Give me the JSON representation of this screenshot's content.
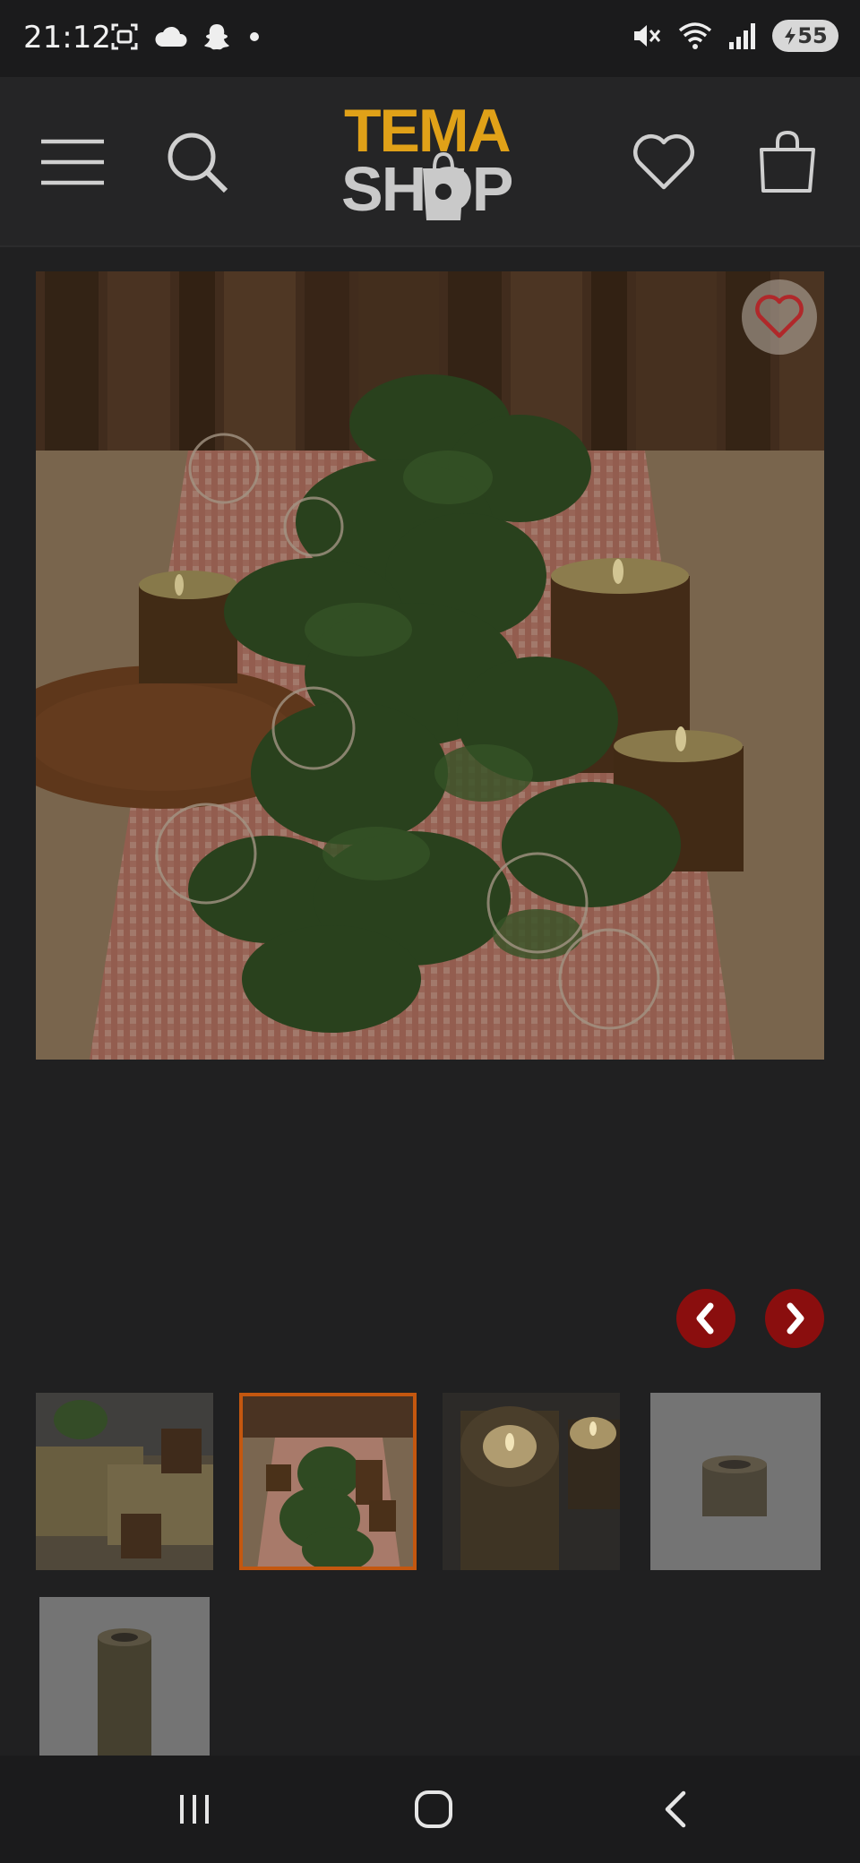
{
  "status_bar": {
    "time": "21:12",
    "battery_level": "55",
    "left_icons": [
      "screenshot-icon",
      "cloud-icon",
      "snapchat-icon",
      "notification-dot-icon"
    ],
    "right_icons": [
      "mute-icon",
      "wifi-icon",
      "signal-icon",
      "battery-charging-icon"
    ]
  },
  "header": {
    "logo_top": "TEMA",
    "logo_bottom": "SHOP",
    "icons": [
      "menu-icon",
      "search-icon",
      "wishlist-icon",
      "cart-icon"
    ],
    "brand_color": "#e0a118"
  },
  "product": {
    "main_image": "table-runner-with-ivy-garland-candles-and-bulbs",
    "favorite_icon": "heart-icon"
  },
  "gallery": {
    "prev_icon": "chevron-left-icon",
    "next_icon": "chevron-right-icon",
    "arrow_color": "#8a0e0e",
    "selected_border_color": "#c4570f",
    "thumbnails": [
      {
        "image": "hay-bales-with-wooden-candle-holders",
        "selected": false
      },
      {
        "image": "table-runner-with-ivy-garland",
        "selected": true
      },
      {
        "image": "wooden-tealight-holders-closeup",
        "selected": false
      },
      {
        "image": "small-wooden-tealight-holder",
        "selected": false
      },
      {
        "image": "tall-wooden-candle-holder",
        "selected": false
      }
    ]
  },
  "nav_bar": {
    "icons": [
      "recent-apps-icon",
      "home-icon",
      "back-icon"
    ]
  }
}
